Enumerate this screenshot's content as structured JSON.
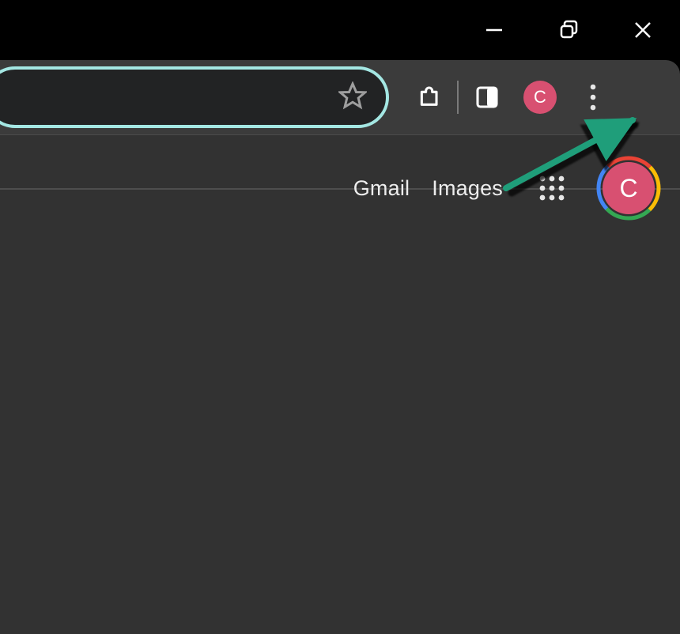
{
  "window": {
    "minimize_label": "Minimize",
    "maximize_label": "Maximize",
    "close_label": "Close"
  },
  "toolbar": {
    "address_value": "",
    "bookmark_label": "Bookmark this tab",
    "extensions_label": "Extensions",
    "sidepanel_label": "Side panel",
    "profile_initial": "C",
    "menu_label": "Customize and control Google Chrome"
  },
  "page": {
    "links": {
      "gmail": "Gmail",
      "images": "Images"
    },
    "apps_label": "Google apps",
    "account_initial": "C"
  },
  "annotation": {
    "target": "menu-button",
    "color": "#1f9e7a"
  }
}
